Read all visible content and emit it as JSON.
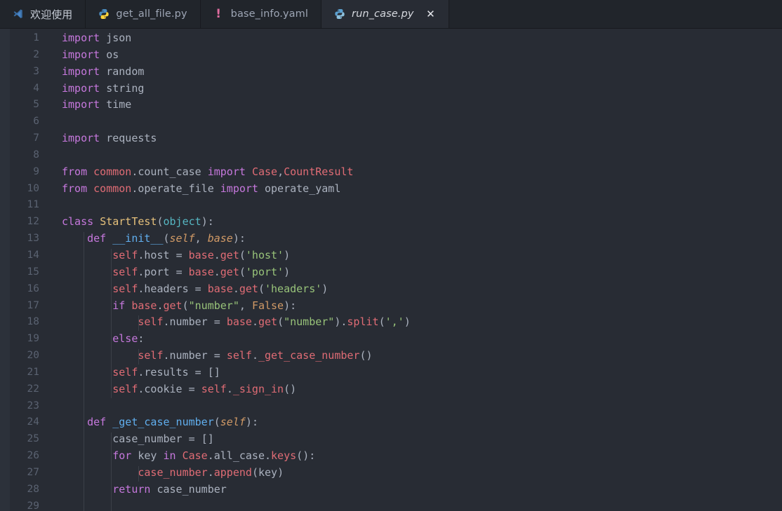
{
  "window": {
    "editor_background": "#282c34",
    "tabbar_background": "#21252b"
  },
  "tabs": [
    {
      "label": "欢迎使用",
      "icon": "vscode-logo-icon",
      "active": false,
      "closable": false,
      "kind": "welcome"
    },
    {
      "label": "get_all_file.py",
      "icon": "python-file-icon",
      "active": false,
      "closable": false,
      "kind": "python"
    },
    {
      "label": "base_info.yaml",
      "icon": "yaml-file-icon",
      "active": false,
      "closable": false,
      "kind": "yaml"
    },
    {
      "label": "run_case.py",
      "icon": "python-file-icon",
      "active": true,
      "closable": true,
      "kind": "python",
      "close_label": "✕"
    }
  ],
  "editor": {
    "language": "python",
    "first_line": 1,
    "last_visible_line": 29,
    "line_numbers": [
      "1",
      "2",
      "3",
      "4",
      "5",
      "6",
      "7",
      "8",
      "9",
      "10",
      "11",
      "12",
      "13",
      "14",
      "15",
      "16",
      "17",
      "18",
      "19",
      "20",
      "21",
      "22",
      "23",
      "24",
      "25",
      "26",
      "27",
      "28",
      "29"
    ],
    "lines": [
      {
        "n": "1",
        "text": "import json"
      },
      {
        "n": "2",
        "text": "import os"
      },
      {
        "n": "3",
        "text": "import random"
      },
      {
        "n": "4",
        "text": "import string"
      },
      {
        "n": "5",
        "text": "import time"
      },
      {
        "n": "6",
        "text": ""
      },
      {
        "n": "7",
        "text": "import requests"
      },
      {
        "n": "8",
        "text": ""
      },
      {
        "n": "9",
        "text": "from common.count_case import Case,CountResult"
      },
      {
        "n": "10",
        "text": "from common.operate_file import operate_yaml"
      },
      {
        "n": "11",
        "text": ""
      },
      {
        "n": "12",
        "text": "class StartTest(object):"
      },
      {
        "n": "13",
        "text": "    def __init__(self, base):"
      },
      {
        "n": "14",
        "text": "        self.host = base.get('host')"
      },
      {
        "n": "15",
        "text": "        self.port = base.get('port')"
      },
      {
        "n": "16",
        "text": "        self.headers = base.get('headers')"
      },
      {
        "n": "17",
        "text": "        if base.get(\"number\", False):"
      },
      {
        "n": "18",
        "text": "            self.number = base.get(\"number\").split(',')"
      },
      {
        "n": "19",
        "text": "        else:"
      },
      {
        "n": "20",
        "text": "            self.number = self._get_case_number()"
      },
      {
        "n": "21",
        "text": "        self.results = []"
      },
      {
        "n": "22",
        "text": "        self.cookie = self._sign_in()"
      },
      {
        "n": "23",
        "text": ""
      },
      {
        "n": "24",
        "text": "    def _get_case_number(self):"
      },
      {
        "n": "25",
        "text": "        case_number = []"
      },
      {
        "n": "26",
        "text": "        for key in Case.all_case.keys():"
      },
      {
        "n": "27",
        "text": "            case_number.append(key)"
      },
      {
        "n": "28",
        "text": "        return case_number"
      },
      {
        "n": "29",
        "text": ""
      }
    ]
  },
  "theme_colors": {
    "keyword": "#c678dd",
    "class_name": "#e5c07b",
    "builtin": "#56b6c2",
    "function": "#61afef",
    "variable": "#e06c75",
    "string": "#98c379",
    "constant": "#d19a66",
    "text": "#abb2bf",
    "line_number": "#5a6271",
    "indent_guide": "#3b4048"
  }
}
